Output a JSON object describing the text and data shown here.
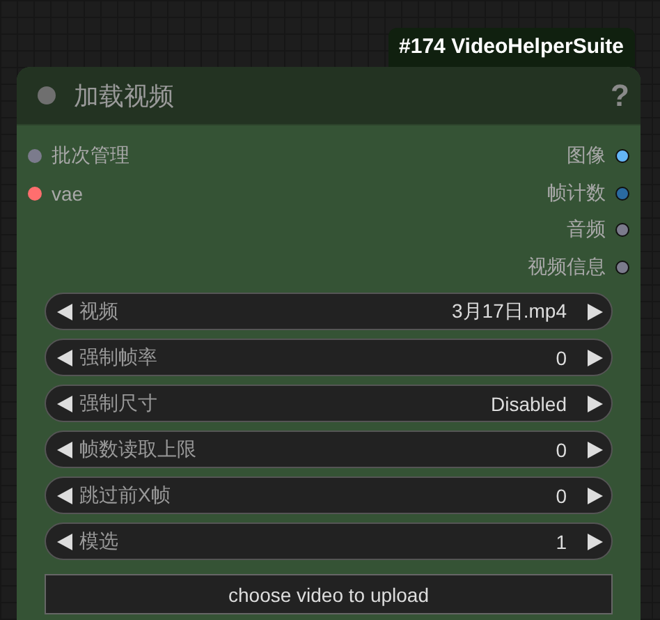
{
  "badge": "#174 VideoHelperSuite",
  "node": {
    "title": "加载视频",
    "help": "?",
    "inputs": [
      {
        "label": "批次管理",
        "color": "#7b7b8c"
      },
      {
        "label": "vae",
        "color": "#ff6e6e"
      }
    ],
    "outputs": [
      {
        "label": "图像",
        "color": "#64b5f6"
      },
      {
        "label": "帧计数",
        "color": "#2a6aa0"
      },
      {
        "label": "音频",
        "color": "#7b7b8c"
      },
      {
        "label": "视频信息",
        "color": "#7b7b8c"
      }
    ],
    "widgets": [
      {
        "label": "视频",
        "value": "3月17日.mp4"
      },
      {
        "label": "强制帧率",
        "value": "0"
      },
      {
        "label": "强制尺寸",
        "value": "Disabled"
      },
      {
        "label": "帧数读取上限",
        "value": "0"
      },
      {
        "label": "跳过前X帧",
        "value": "0"
      },
      {
        "label": "模选",
        "value": "1"
      }
    ],
    "upload_button": "choose video to upload"
  }
}
